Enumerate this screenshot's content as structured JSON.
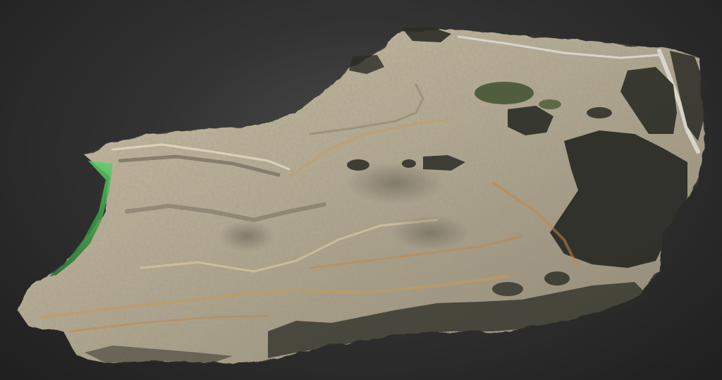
{
  "viewer": {
    "background_color": "#262626"
  },
  "scene": {
    "subject": "photogrammetry-terrain-model",
    "ground_color": "#b5ab94",
    "vegetation_color": "#2a2c26",
    "water_color": "#4c5a3a",
    "road_color": "#d8d5cc",
    "edge_highlight_color": "#3fae4a"
  }
}
